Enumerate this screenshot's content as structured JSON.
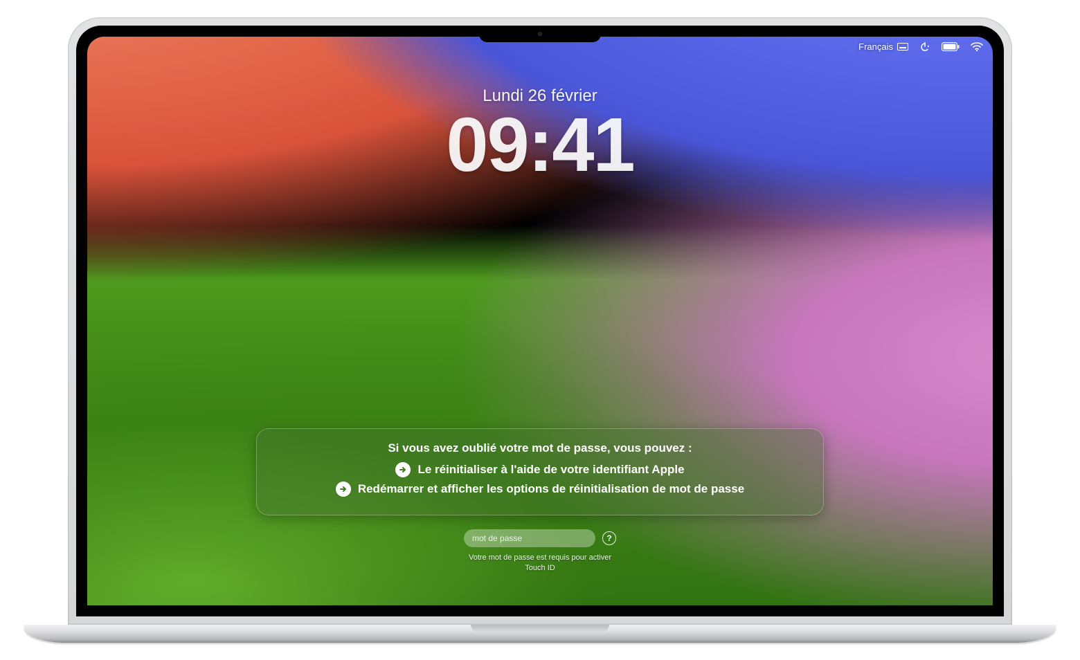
{
  "menubar": {
    "language_label": "Français",
    "icons": {
      "keyboard": "keyboard-icon",
      "power": "power-icon",
      "battery": "battery-icon",
      "wifi": "wifi-icon"
    }
  },
  "clock": {
    "date": "Lundi 26 février",
    "time": "09:41"
  },
  "recovery": {
    "title": "Si vous avez oublié votre mot de passe, vous pouvez :",
    "options": [
      "Le réinitialiser à l'aide de votre identifiant Apple",
      "Redémarrer et afficher les options de réinitialisation de mot de passe"
    ]
  },
  "password": {
    "placeholder": "mot de passe",
    "value": "",
    "hint_icon": "?",
    "message": "Votre mot de passe est requis pour activer Touch ID"
  }
}
